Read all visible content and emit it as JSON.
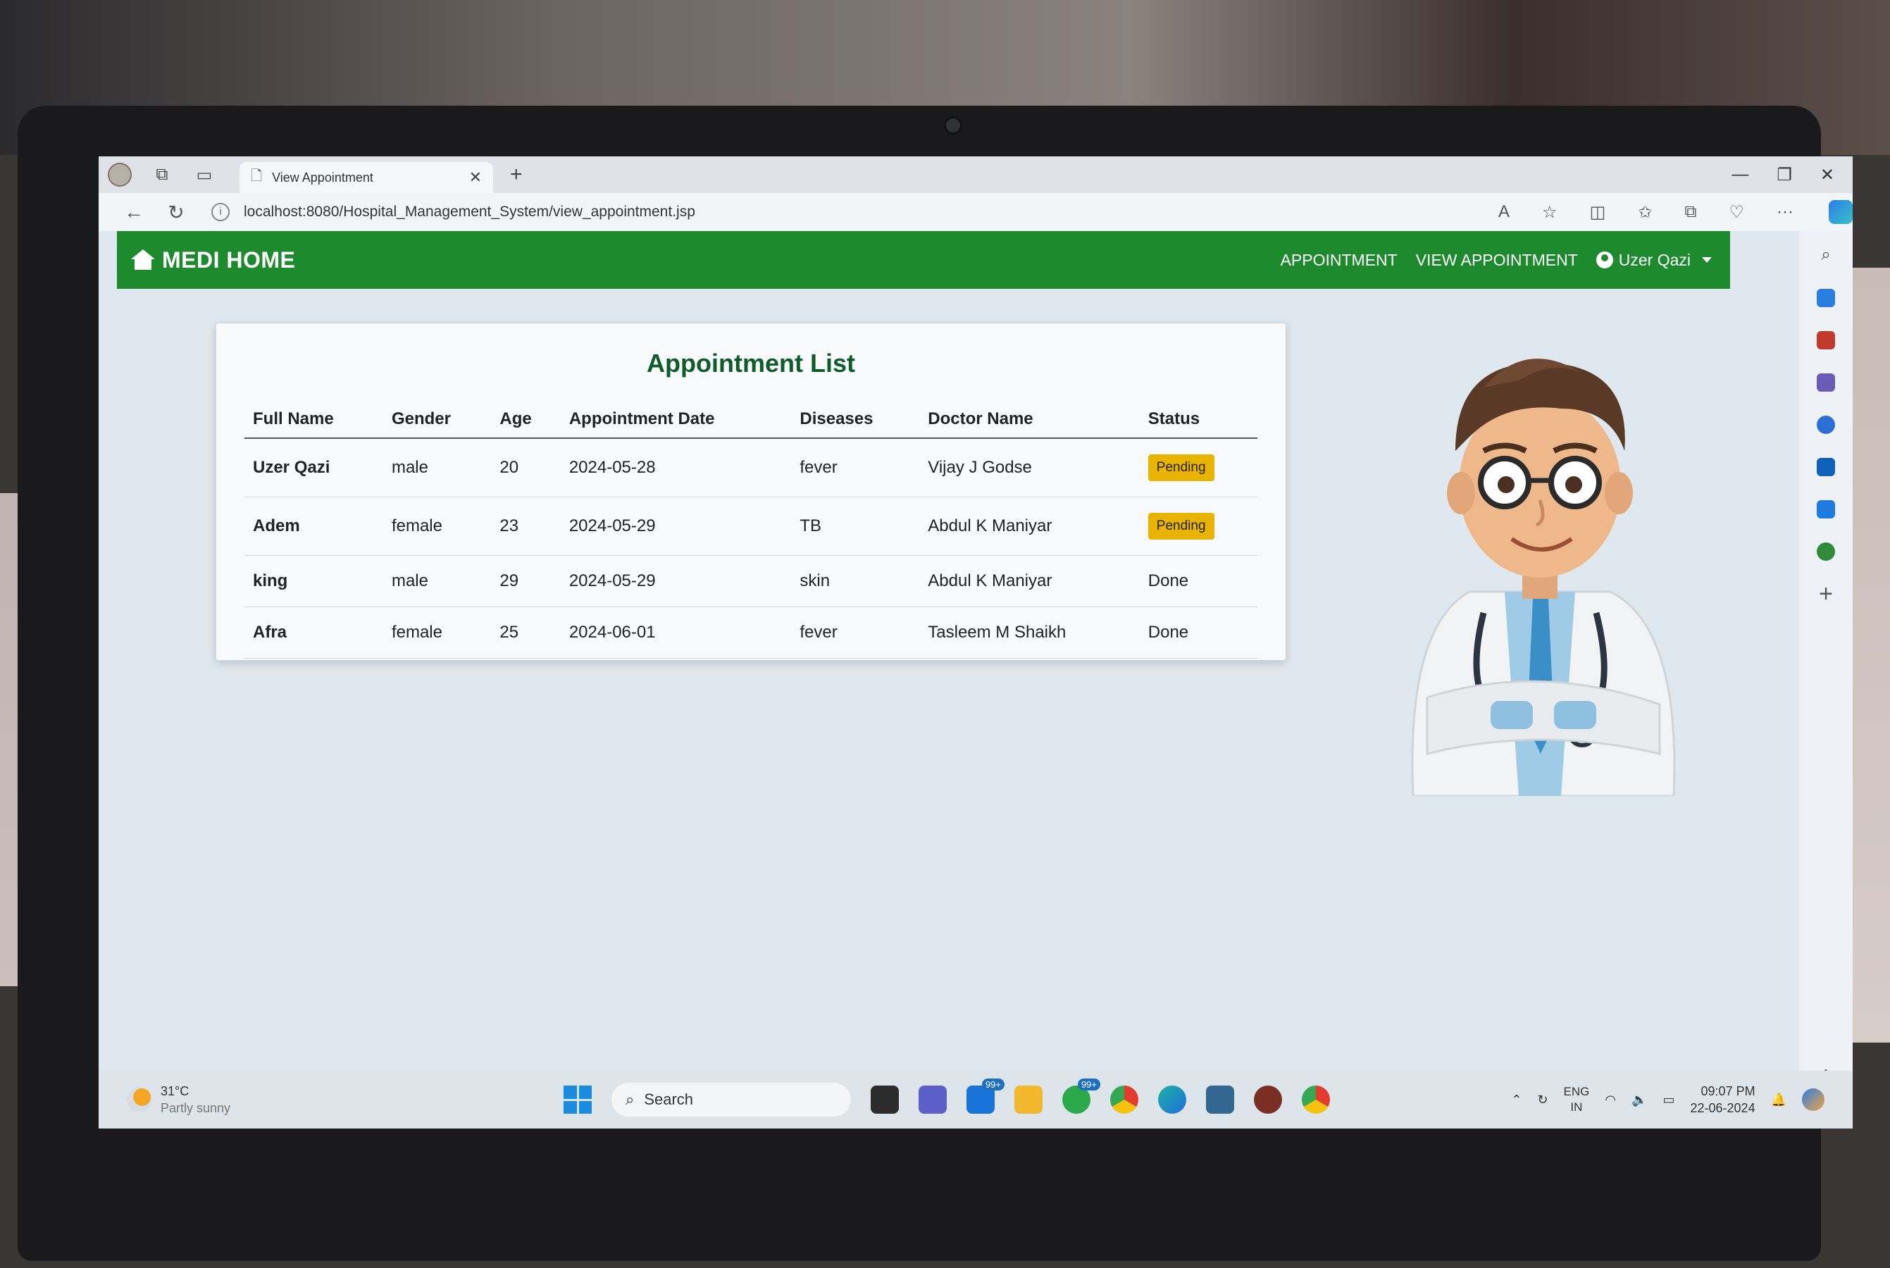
{
  "browser": {
    "tab_title": "View Appointment",
    "url": "localhost:8080/Hospital_Management_System/view_appointment.jsp"
  },
  "navbar": {
    "brand": "MEDI HOME",
    "links": [
      "APPOINTMENT",
      "VIEW APPOINTMENT"
    ],
    "user": "Uzer Qazi",
    "color": "#1e8a2e"
  },
  "card": {
    "title": "Appointment List",
    "columns": [
      "Full Name",
      "Gender",
      "Age",
      "Appointment Date",
      "Diseases",
      "Doctor Name",
      "Status"
    ],
    "rows": [
      {
        "name": "Uzer Qazi",
        "gender": "male",
        "age": "20",
        "date": "2024-05-28",
        "disease": "fever",
        "doctor": "Vijay J Godse",
        "status": "Pending"
      },
      {
        "name": "Adem",
        "gender": "female",
        "age": "23",
        "date": "2024-05-29",
        "disease": "TB",
        "doctor": "Abdul K Maniyar",
        "status": "Pending"
      },
      {
        "name": "king",
        "gender": "male",
        "age": "29",
        "date": "2024-05-29",
        "disease": "skin",
        "doctor": "Abdul K Maniyar",
        "status": "Done"
      },
      {
        "name": "Afra",
        "gender": "female",
        "age": "25",
        "date": "2024-06-01",
        "disease": "fever",
        "doctor": "Tasleem M Shaikh",
        "status": "Done"
      }
    ]
  },
  "taskbar": {
    "weather_temp": "31°C",
    "weather_desc": "Partly sunny",
    "search_label": "Search",
    "mail_badge": "99+",
    "whatsapp_badge": "99+",
    "lang_line1": "ENG",
    "lang_line2": "IN",
    "time": "09:07 PM",
    "date": "22-06-2024"
  }
}
